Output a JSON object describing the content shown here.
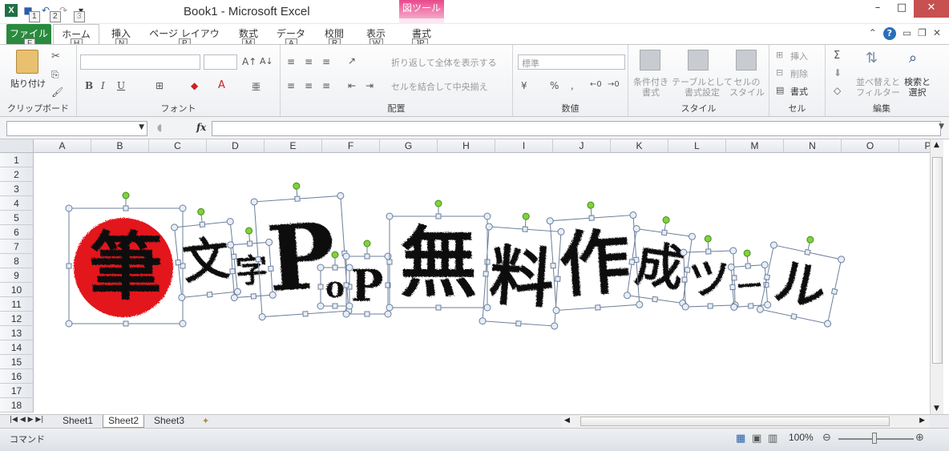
{
  "window": {
    "title": "Book1 - Microsoft Excel",
    "context_tab": "図ツール"
  },
  "qat": {
    "keytips": [
      "1",
      "2",
      "3"
    ]
  },
  "tabs": [
    {
      "label": "ファイル",
      "keytip": "F"
    },
    {
      "label": "ホーム",
      "keytip": "H"
    },
    {
      "label": "挿入",
      "keytip": "N"
    },
    {
      "label": "ページ レイアウト",
      "keytip": "P"
    },
    {
      "label": "数式",
      "keytip": "M"
    },
    {
      "label": "データ",
      "keytip": "A"
    },
    {
      "label": "校閲",
      "keytip": "R"
    },
    {
      "label": "表示",
      "keytip": "W"
    },
    {
      "label": "書式",
      "keytip": "JP"
    }
  ],
  "ribbon": {
    "clipboard": {
      "label": "クリップボード",
      "paste": "貼り付け"
    },
    "font": {
      "label": "フォント",
      "bold": "B",
      "italic": "I",
      "underline": "U"
    },
    "alignment": {
      "label": "配置",
      "wrap": "折り返して全体を表示する",
      "merge": "セルを結合して中央揃え"
    },
    "number": {
      "label": "数値",
      "format": "標準"
    },
    "styles": {
      "label": "スタイル",
      "conditional": "条件付き\n書式",
      "table": "テーブルとして\n書式設定",
      "cell": "セルの\nスタイル"
    },
    "cells": {
      "label": "セル",
      "insert": "挿入",
      "delete": "削除",
      "format": "書式"
    },
    "editing": {
      "label": "編集",
      "sort": "並べ替えと\nフィルター",
      "find": "検索と\n選択"
    }
  },
  "formula_bar": {
    "fx": "fx",
    "name": "",
    "formula": ""
  },
  "columns": [
    "A",
    "B",
    "C",
    "D",
    "E",
    "F",
    "G",
    "H",
    "I",
    "J",
    "K",
    "L",
    "M",
    "N",
    "O",
    "P"
  ],
  "rows": [
    "1",
    "2",
    "3",
    "4",
    "5",
    "6",
    "7",
    "8",
    "9",
    "10",
    "11",
    "12",
    "13",
    "14",
    "15",
    "16",
    "17",
    "18"
  ],
  "artwork": {
    "glyphs": [
      "筆",
      "文",
      "字",
      "P",
      "o",
      "P",
      "無",
      "料",
      "作",
      "成",
      "ツ",
      "ー",
      "ル"
    ]
  },
  "sheets": [
    "Sheet1",
    "Sheet2",
    "Sheet3"
  ],
  "active_sheet": "Sheet2",
  "status": {
    "mode": "コマンド",
    "zoom": "100%"
  }
}
